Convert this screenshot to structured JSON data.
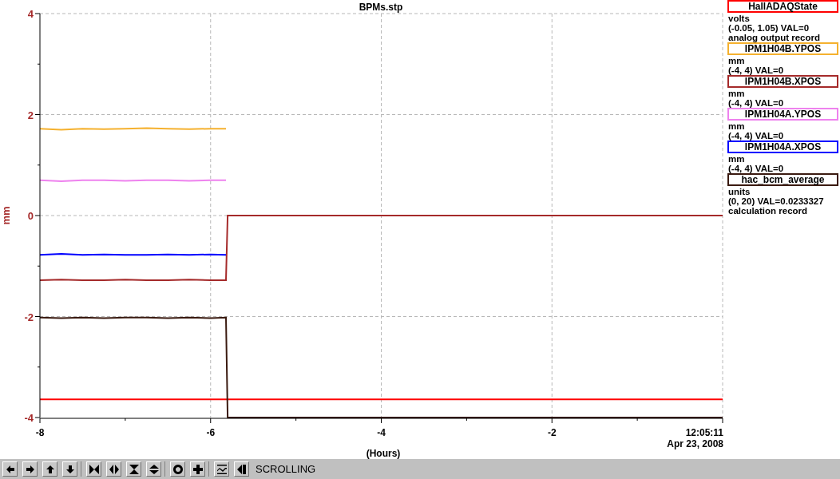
{
  "window": {
    "title": "BPMs.stp"
  },
  "plot": {
    "chart_data": {
      "type": "line",
      "xlabel": "(Hours)",
      "ylabel": "mm",
      "x": [
        -8,
        -7.75,
        -7.5,
        -7.25,
        -7,
        -6.75,
        -6.5,
        -6.25,
        -6,
        -5.82,
        -5.8,
        -4,
        -2,
        0
      ],
      "xlim": [
        -8,
        0
      ],
      "ylim": [
        -4,
        4
      ],
      "xticks": [
        -8,
        -6,
        -4,
        -2
      ],
      "yticks": [
        -4,
        -2,
        0,
        2,
        4
      ],
      "grid": true,
      "series": [
        {
          "name": "HallADAQState",
          "color": "#ff0000",
          "values": [
            -3.64,
            -3.64,
            -3.64,
            -3.64,
            -3.64,
            -3.64,
            -3.64,
            -3.64,
            -3.64,
            -3.64,
            -3.64,
            -3.64,
            -3.64,
            -3.64
          ]
        },
        {
          "name": "IPM1H04B.YPOS",
          "color": "#f5b12f",
          "values": [
            1.72,
            1.7,
            1.72,
            1.71,
            1.72,
            1.73,
            1.72,
            1.71,
            1.72,
            1.72,
            null,
            null,
            null,
            null
          ]
        },
        {
          "name": "IPM1H04B.XPOS",
          "color": "#a52a2a",
          "values": [
            -1.28,
            -1.27,
            -1.28,
            -1.28,
            -1.27,
            -1.28,
            -1.28,
            -1.27,
            -1.28,
            -1.28,
            0,
            0,
            0,
            0
          ]
        },
        {
          "name": "IPM1H04A.YPOS",
          "color": "#ee82ee",
          "values": [
            0.7,
            0.68,
            0.7,
            0.7,
            0.69,
            0.7,
            0.7,
            0.69,
            0.7,
            0.7,
            null,
            null,
            null,
            null
          ]
        },
        {
          "name": "IPM1H04A.XPOS",
          "color": "#0000ff",
          "values": [
            -0.78,
            -0.76,
            -0.78,
            -0.77,
            -0.78,
            -0.78,
            -0.77,
            -0.78,
            -0.77,
            -0.78,
            null,
            null,
            null,
            null
          ]
        },
        {
          "name": "hac_bcm_average",
          "color": "#3a1a10",
          "values": [
            -2.02,
            -2.03,
            -2.02,
            -2.03,
            -2.02,
            -2.02,
            -2.03,
            -2.02,
            -2.03,
            -2.02,
            -4,
            -4,
            -4,
            -4
          ]
        }
      ]
    },
    "time_label": "12:05:11",
    "date_label": "Apr 23, 2008"
  },
  "legend": [
    {
      "lines": [
        "volts",
        "(-0.05, 1.05) VAL=0",
        "analog output record"
      ]
    },
    {
      "lines": [
        "mm",
        "(-4, 4) VAL=0"
      ]
    },
    {
      "lines": [
        "mm",
        "(-4, 4) VAL=0"
      ]
    },
    {
      "lines": [
        "mm",
        "(-4, 4) VAL=0"
      ]
    },
    {
      "lines": [
        "mm",
        "(-4, 4) VAL=0"
      ]
    },
    {
      "lines": [
        "units",
        "(0, 20) VAL=0.0233327",
        "calculation record"
      ]
    }
  ],
  "toolbar": {
    "groups": [
      [
        {
          "kind": "left"
        },
        {
          "kind": "right"
        },
        {
          "kind": "up"
        },
        {
          "kind": "down"
        }
      ],
      [
        {
          "kind": "zoom-in-x"
        },
        {
          "kind": "zoom-out-x"
        },
        {
          "kind": "zoom-in-y"
        },
        {
          "kind": "zoom-out-y"
        }
      ],
      [
        {
          "kind": "circle"
        },
        {
          "kind": "plus"
        }
      ],
      [
        {
          "kind": "graph"
        },
        {
          "kind": "back"
        }
      ]
    ],
    "status": "SCROLLING"
  }
}
